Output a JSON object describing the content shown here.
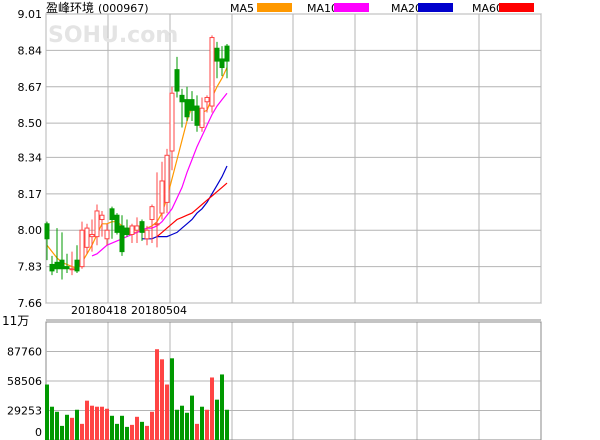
{
  "title": "盈峰环境",
  "code": "(000967)",
  "watermark": "SOHU.com",
  "legend": [
    {
      "name": "MA5",
      "color": "#ff9900"
    },
    {
      "name": "MA10",
      "color": "#ff00ff"
    },
    {
      "name": "MA20",
      "color": "#0000cc"
    },
    {
      "name": "MA60",
      "color": "#ff0000"
    }
  ],
  "volume_unit": "11万",
  "colors": {
    "up": "#ff4444",
    "down": "#009900",
    "grid": "#b4b4b4",
    "border": "#888888"
  },
  "chart_data": [
    {
      "type": "candlestick",
      "ylim": [
        7.66,
        9.01
      ],
      "yticks": [
        "9.01",
        "8.84",
        "8.67",
        "8.50",
        "8.34",
        "8.17",
        "8.00",
        "7.83",
        "7.66"
      ],
      "xlabels": [
        {
          "index": 8,
          "text": "20180418"
        },
        {
          "index": 20,
          "text": "20180504"
        }
      ],
      "candles": [
        {
          "o": 8.03,
          "h": 8.04,
          "l": 7.86,
          "c": 7.96
        },
        {
          "o": 7.84,
          "h": 7.88,
          "l": 7.79,
          "c": 7.81
        },
        {
          "o": 7.85,
          "h": 8.01,
          "l": 7.8,
          "c": 7.82
        },
        {
          "o": 7.86,
          "h": 7.99,
          "l": 7.77,
          "c": 7.82
        },
        {
          "o": 7.83,
          "h": 7.89,
          "l": 7.8,
          "c": 7.82
        },
        {
          "o": 7.82,
          "h": 7.9,
          "l": 7.79,
          "c": 7.82
        },
        {
          "o": 7.86,
          "h": 7.93,
          "l": 7.8,
          "c": 7.81
        },
        {
          "o": 7.83,
          "h": 8.04,
          "l": 7.82,
          "c": 8.0
        },
        {
          "o": 7.92,
          "h": 8.03,
          "l": 7.89,
          "c": 8.01
        },
        {
          "o": 7.97,
          "h": 8.05,
          "l": 7.9,
          "c": 7.98
        },
        {
          "o": 7.97,
          "h": 8.12,
          "l": 7.93,
          "c": 8.09
        },
        {
          "o": 8.05,
          "h": 8.09,
          "l": 7.97,
          "c": 8.07
        },
        {
          "o": 7.96,
          "h": 8.03,
          "l": 7.93,
          "c": 8.0
        },
        {
          "o": 8.1,
          "h": 8.11,
          "l": 7.96,
          "c": 8.05
        },
        {
          "o": 8.07,
          "h": 8.08,
          "l": 7.98,
          "c": 7.99
        },
        {
          "o": 8.02,
          "h": 8.07,
          "l": 7.88,
          "c": 7.9
        },
        {
          "o": 8.01,
          "h": 8.05,
          "l": 7.97,
          "c": 7.98
        },
        {
          "o": 7.98,
          "h": 8.03,
          "l": 7.94,
          "c": 8.02
        },
        {
          "o": 8.0,
          "h": 8.06,
          "l": 7.94,
          "c": 8.02
        },
        {
          "o": 8.04,
          "h": 8.05,
          "l": 7.95,
          "c": 7.99
        },
        {
          "o": 7.96,
          "h": 8.02,
          "l": 7.93,
          "c": 8.0
        },
        {
          "o": 8.05,
          "h": 8.12,
          "l": 7.94,
          "c": 8.11
        },
        {
          "o": 8.03,
          "h": 8.27,
          "l": 7.92,
          "c": 8.03
        },
        {
          "o": 8.08,
          "h": 8.32,
          "l": 8.05,
          "c": 8.23
        },
        {
          "o": 8.13,
          "h": 8.38,
          "l": 8.08,
          "c": 8.35
        },
        {
          "o": 8.37,
          "h": 8.67,
          "l": 8.28,
          "c": 8.64
        },
        {
          "o": 8.75,
          "h": 8.81,
          "l": 8.62,
          "c": 8.65
        },
        {
          "o": 8.63,
          "h": 8.66,
          "l": 8.48,
          "c": 8.6
        },
        {
          "o": 8.61,
          "h": 8.67,
          "l": 8.51,
          "c": 8.53
        },
        {
          "o": 8.61,
          "h": 8.65,
          "l": 8.51,
          "c": 8.56
        },
        {
          "o": 8.58,
          "h": 8.63,
          "l": 8.46,
          "c": 8.49
        },
        {
          "o": 8.48,
          "h": 8.62,
          "l": 8.46,
          "c": 8.57
        },
        {
          "o": 8.6,
          "h": 8.63,
          "l": 8.55,
          "c": 8.62
        },
        {
          "o": 8.58,
          "h": 8.91,
          "l": 8.55,
          "c": 8.9
        },
        {
          "o": 8.85,
          "h": 8.88,
          "l": 8.71,
          "c": 8.79
        },
        {
          "o": 8.8,
          "h": 8.86,
          "l": 8.72,
          "c": 8.76
        },
        {
          "o": 8.86,
          "h": 8.87,
          "l": 8.71,
          "c": 8.79
        }
      ],
      "ma": {
        "MA5": [
          7.93,
          7.9,
          7.87,
          7.85,
          7.84,
          7.83,
          7.82,
          7.85,
          7.89,
          7.93,
          7.98,
          8.03,
          8.03,
          8.04,
          8.04,
          8.02,
          8.0,
          7.99,
          7.99,
          8.0,
          8.01,
          8.02,
          8.04,
          8.08,
          8.15,
          8.24,
          8.33,
          8.42,
          8.51,
          8.58,
          8.56,
          8.55,
          8.56,
          8.62,
          8.67,
          8.71,
          8.76
        ],
        "MA10": [
          null,
          null,
          null,
          null,
          null,
          null,
          null,
          null,
          null,
          7.88,
          7.89,
          7.91,
          7.93,
          7.94,
          7.95,
          7.96,
          7.97,
          7.98,
          7.99,
          8.0,
          8.01,
          8.01,
          8.02,
          8.04,
          8.07,
          8.1,
          8.15,
          8.2,
          8.27,
          8.33,
          8.39,
          8.44,
          8.49,
          8.54,
          8.58,
          8.61,
          8.64
        ],
        "MA20": [
          null,
          null,
          null,
          null,
          null,
          null,
          null,
          null,
          null,
          null,
          null,
          null,
          null,
          null,
          null,
          null,
          null,
          null,
          null,
          7.96,
          7.96,
          7.96,
          7.97,
          7.97,
          7.97,
          7.98,
          7.99,
          8.01,
          8.03,
          8.05,
          8.08,
          8.1,
          8.13,
          8.17,
          8.21,
          8.25,
          8.3
        ],
        "MA60": [
          null,
          null,
          null,
          null,
          null,
          null,
          null,
          null,
          null,
          null,
          null,
          null,
          null,
          null,
          null,
          null,
          null,
          null,
          null,
          null,
          null,
          null,
          7.97,
          7.99,
          8.01,
          8.03,
          8.05,
          8.06,
          8.07,
          8.08,
          8.1,
          8.12,
          8.14,
          8.16,
          8.18,
          8.2,
          8.22
        ]
      }
    },
    {
      "type": "bar",
      "title": "volume",
      "ylim": [
        0,
        117000
      ],
      "yticks": [
        "87760",
        "58506",
        "29253",
        "0"
      ],
      "values": [
        55000,
        33000,
        28000,
        14000,
        25000,
        22000,
        30000,
        16000,
        39000,
        34000,
        33000,
        33000,
        31000,
        24000,
        16000,
        24000,
        13000,
        15000,
        23000,
        18000,
        14000,
        28000,
        90000,
        80000,
        55000,
        81000,
        30000,
        34000,
        27000,
        44000,
        16000,
        33000,
        30000,
        62000,
        40000,
        65000,
        30000
      ],
      "up": [
        false,
        false,
        false,
        false,
        false,
        true,
        false,
        true,
        true,
        true,
        true,
        true,
        true,
        false,
        false,
        false,
        false,
        true,
        true,
        false,
        true,
        true,
        true,
        true,
        true,
        false,
        false,
        false,
        false,
        false,
        true,
        false,
        true,
        true,
        false,
        false,
        false
      ]
    }
  ]
}
